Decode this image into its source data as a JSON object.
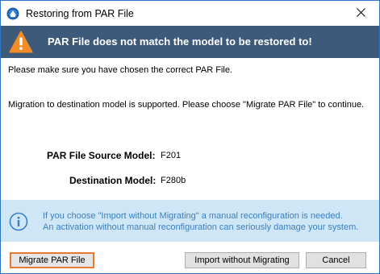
{
  "window": {
    "title": "Restoring from PAR File"
  },
  "banner": {
    "text": "PAR File does not match the model to be restored to!"
  },
  "messages": {
    "check": "Please make sure you have chosen the correct PAR File.",
    "migration": "Migration to destination model is supported. Please choose \"Migrate PAR File\" to continue."
  },
  "models": {
    "source_label": "PAR File Source Model:",
    "source_value": "F201",
    "destination_label": "Destination Model:",
    "destination_value": "F280b"
  },
  "info": {
    "line1": "If you choose \"Import without Migrating\" a manual reconfiguration is needed.",
    "line2": "An activation without manual reconfiguration can seriously damage your system."
  },
  "buttons": {
    "migrate": "Migrate PAR File",
    "import": "Import without Migrating",
    "cancel": "Cancel"
  },
  "icons": {
    "app": "app-icon",
    "close": "close-icon",
    "warning": "warning-icon",
    "info": "info-icon"
  },
  "colors": {
    "banner_bg": "#3e5a7b",
    "warning": "#f28c28",
    "info_bg": "#cfe6f6",
    "info_text": "#3a7fc1",
    "focus_border": "#e8792e",
    "window_border": "#2a74c7"
  }
}
